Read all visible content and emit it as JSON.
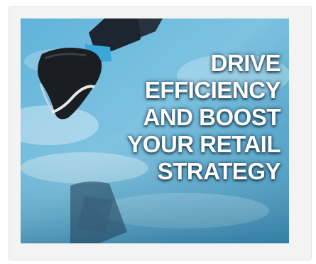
{
  "ad": {
    "headline_lines": [
      "DRIVE",
      "EFFICIENCY",
      "AND BOOST",
      "YOUR RETAIL",
      "STRATEGY"
    ]
  }
}
